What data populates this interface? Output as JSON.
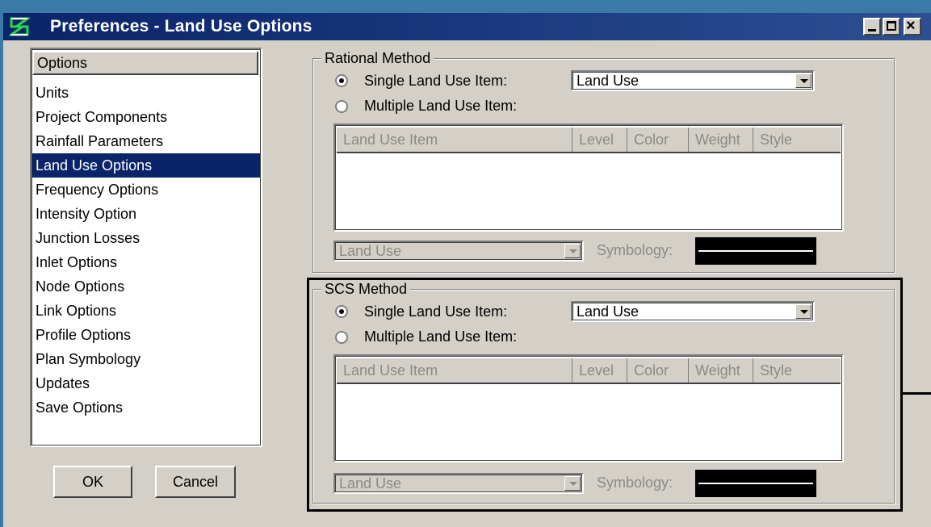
{
  "window": {
    "title": "Preferences - Land Use Options",
    "colors": {
      "titlebar": "#0a246a",
      "face": "#d4d0c8",
      "selection": "#0a246a"
    }
  },
  "options_list": {
    "header": "Options",
    "items": [
      {
        "label": "Units"
      },
      {
        "label": "Project Components"
      },
      {
        "label": "Rainfall Parameters"
      },
      {
        "label": "Land Use Options"
      },
      {
        "label": "Frequency Options"
      },
      {
        "label": "Intensity Option"
      },
      {
        "label": "Junction Losses"
      },
      {
        "label": "Inlet Options"
      },
      {
        "label": "Node Options"
      },
      {
        "label": "Link Options"
      },
      {
        "label": "Profile Options"
      },
      {
        "label": "Plan Symbology"
      },
      {
        "label": "Updates"
      },
      {
        "label": "Save Options"
      }
    ],
    "selected": "Land Use Options"
  },
  "buttons": {
    "ok": "OK",
    "cancel": "Cancel"
  },
  "rational": {
    "title": "Rational Method",
    "single_label": "Single Land Use Item:",
    "single_value": "Land Use",
    "multiple_label": "Multiple Land Use Item:",
    "columns": [
      "Land Use Item",
      "Level",
      "Color",
      "Weight",
      "Style"
    ],
    "land_use_value": "Land Use",
    "symbology_label": "Symbology:"
  },
  "scs": {
    "title": "SCS Method",
    "single_label": "Single Land Use Item:",
    "single_value": "Land Use",
    "multiple_label": "Multiple Land Use Item:",
    "columns": [
      "Land Use Item",
      "Level",
      "Color",
      "Weight",
      "Style"
    ],
    "land_use_value": "Land Use",
    "symbology_label": "Symbology:"
  }
}
